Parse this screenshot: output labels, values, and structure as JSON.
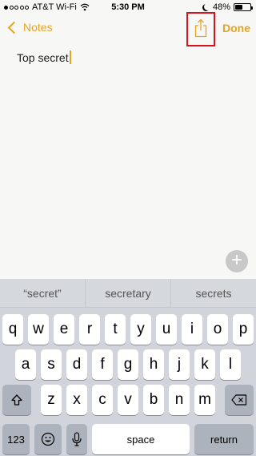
{
  "status_bar": {
    "carrier": "AT&T Wi-Fi",
    "time": "5:30 PM",
    "battery_percent_label": "48%",
    "battery_level": 0.48,
    "signal_bars_filled": 1,
    "signal_bars_total": 5
  },
  "nav": {
    "back_label": "Notes",
    "done_label": "Done",
    "accent_color": "#e5a521",
    "highlight_color": "#d8121a"
  },
  "note": {
    "text": "Top secret"
  },
  "plus_button": {
    "label": "+"
  },
  "suggestions": [
    "“secret”",
    "secretary",
    "secrets"
  ],
  "keyboard": {
    "row1": [
      "q",
      "w",
      "e",
      "r",
      "t",
      "y",
      "u",
      "i",
      "o",
      "p"
    ],
    "row2": [
      "a",
      "s",
      "d",
      "f",
      "g",
      "h",
      "j",
      "k",
      "l"
    ],
    "row3": [
      "z",
      "x",
      "c",
      "v",
      "b",
      "n",
      "m"
    ],
    "numbers_label": "123",
    "space_label": "space",
    "return_label": "return",
    "icons": {
      "shift": "shift-icon",
      "delete": "delete-icon",
      "emoji": "emoji-icon",
      "mic": "microphone-icon"
    }
  }
}
